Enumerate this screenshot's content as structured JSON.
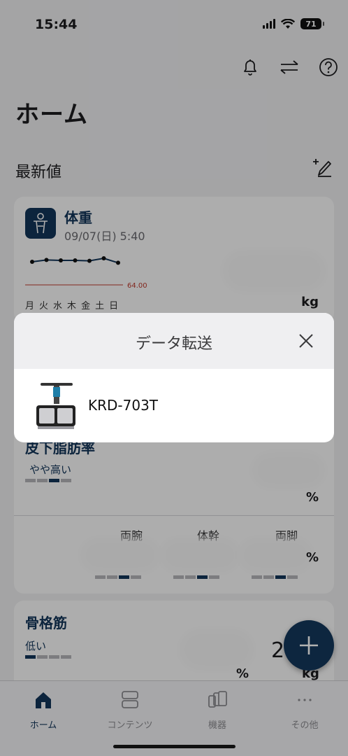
{
  "status_bar": {
    "time": "15:44",
    "battery": "71"
  },
  "header": {
    "title": "ホーム",
    "icons": [
      "bell-icon",
      "transfer-icon",
      "help-icon"
    ]
  },
  "latest": {
    "section_title": "最新値",
    "edit_icon": "edit-add-icon"
  },
  "weight_card": {
    "title": "体重",
    "datetime": "09/07(日) 5:40",
    "target_value": "64.00",
    "days": [
      "月",
      "火",
      "水",
      "木",
      "金",
      "土",
      "日"
    ],
    "unit": "kg",
    "sparkline": [
      0.55,
      0.42,
      0.45,
      0.45,
      0.48,
      0.3,
      0.62
    ]
  },
  "body_fat_card": {
    "title": "皮下脂肪率",
    "level": "やや高い",
    "unit": "%",
    "segments": [
      {
        "label": "両腕",
        "unit": ""
      },
      {
        "label": "体幹",
        "unit": ""
      },
      {
        "label": "両脚",
        "unit": "%"
      }
    ]
  },
  "muscle_card": {
    "title": "骨格筋",
    "level": "低い",
    "unit_pct": "%",
    "unit_kg": "kg",
    "partial_value": "2"
  },
  "modal": {
    "title": "データ転送",
    "device_name": "KRD-703T"
  },
  "tabs": [
    {
      "label": "ホーム",
      "icon": "home-icon",
      "active": true
    },
    {
      "label": "コンテンツ",
      "icon": "content-icon",
      "active": false
    },
    {
      "label": "機器",
      "icon": "devices-icon",
      "active": false
    },
    {
      "label": "その他",
      "icon": "more-icon",
      "active": false
    }
  ],
  "colors": {
    "brand": "#13365a",
    "target_line": "#c0392b"
  }
}
